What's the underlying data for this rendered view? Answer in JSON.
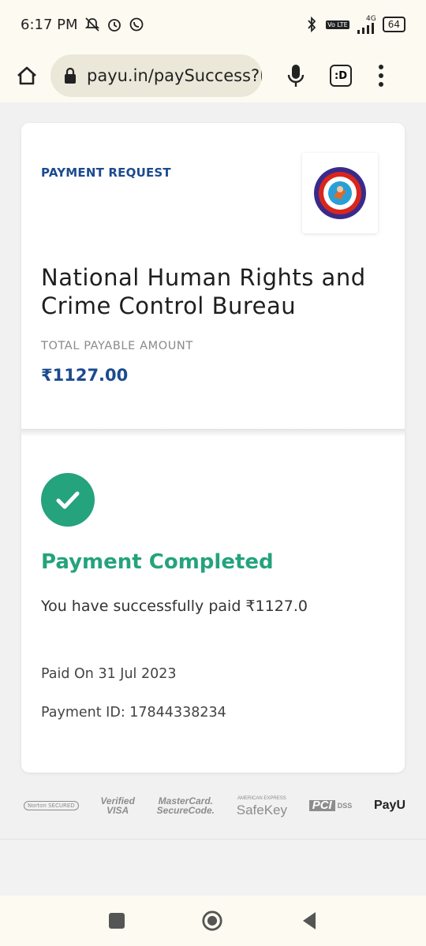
{
  "status_bar": {
    "time": "6:17 PM",
    "network": "4G",
    "volte": "Vo LTE",
    "battery": "64"
  },
  "browser": {
    "url": "payu.in/paySuccess?l",
    "tabs_label": ":D"
  },
  "card": {
    "request_label": "PAYMENT REQUEST",
    "merchant_name": "National Human Rights and Crime Control Bureau",
    "total_label": "TOTAL PAYABLE AMOUNT",
    "amount": "₹1127.00",
    "status_title": "Payment Completed",
    "status_message": "You have successfully paid ₹1127.0",
    "paid_on": "Paid On 31 Jul 2023",
    "payment_id": "Payment ID: 17844338234"
  },
  "footer": {
    "norton": "Norton SECURED",
    "visa_line1": "Verified",
    "visa_line2": "VISA",
    "mc_line1": "MasterCard.",
    "mc_line2": "SecureCode.",
    "amex_small": "AMERICAN EXPRESS",
    "safekey": "SafeKey",
    "pci": "PCI",
    "dss": "DSS",
    "payu": "PayU"
  },
  "colors": {
    "accent_blue": "#1b4a8f",
    "success_green": "#24a37c",
    "browser_bg": "#fdfaf1"
  }
}
